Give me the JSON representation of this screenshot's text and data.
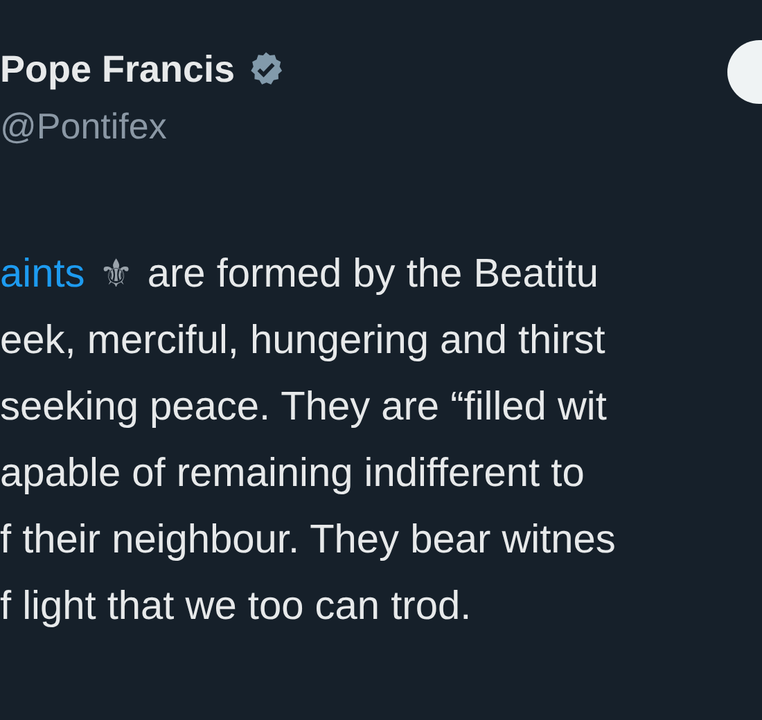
{
  "author": {
    "name": "Pope Francis",
    "verified": true,
    "handle": "@Pontifex"
  },
  "post_lines": [
    {
      "parts": [
        {
          "kind": "link",
          "text": "aints"
        },
        {
          "kind": "emoji",
          "text": "⚜"
        },
        {
          "kind": "text",
          "text": "are formed by the Beatitu"
        }
      ]
    },
    {
      "parts": [
        {
          "kind": "text",
          "text": "eek, merciful, hungering and thirst"
        }
      ]
    },
    {
      "parts": [
        {
          "kind": "text",
          "text": "seeking peace. They are “filled wit"
        }
      ]
    },
    {
      "parts": [
        {
          "kind": "text",
          "text": "apable of remaining indifferent to"
        }
      ]
    },
    {
      "parts": [
        {
          "kind": "text",
          "text": "f their neighbour. They bear witnes"
        }
      ]
    },
    {
      "parts": [
        {
          "kind": "text",
          "text": "f light that we too can trod."
        }
      ]
    }
  ]
}
